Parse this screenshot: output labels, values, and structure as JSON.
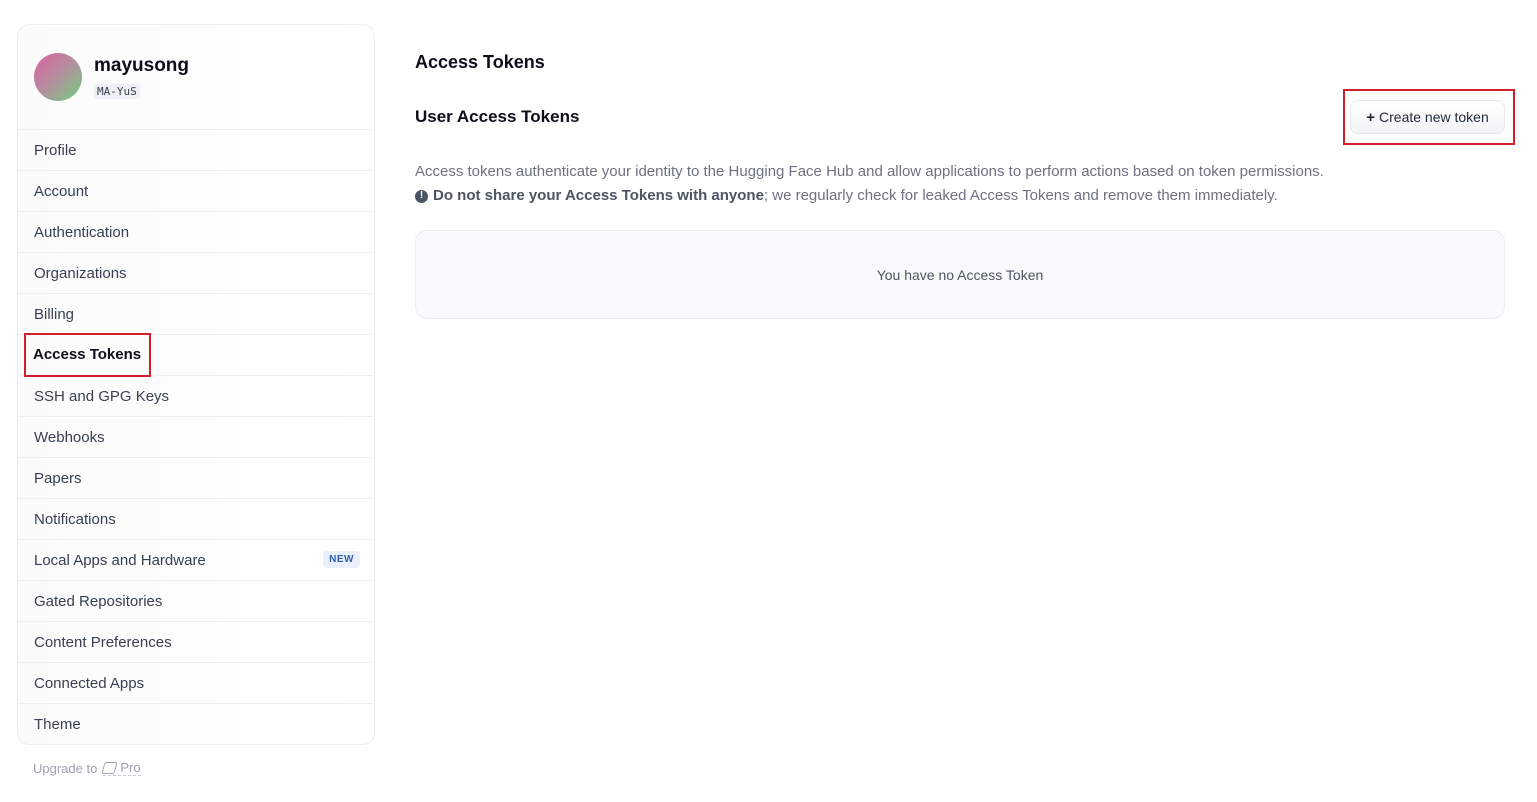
{
  "user": {
    "name": "mayusong",
    "handle": "MA-YuS"
  },
  "sidebar": {
    "items": [
      {
        "label": "Profile"
      },
      {
        "label": "Account"
      },
      {
        "label": "Authentication"
      },
      {
        "label": "Organizations"
      },
      {
        "label": "Billing"
      },
      {
        "label": "Access Tokens",
        "active": true
      },
      {
        "label": "SSH and GPG Keys"
      },
      {
        "label": "Webhooks"
      },
      {
        "label": "Papers"
      },
      {
        "label": "Notifications"
      },
      {
        "label": "Local Apps and Hardware",
        "badge": "NEW"
      },
      {
        "label": "Gated Repositories"
      },
      {
        "label": "Content Preferences"
      },
      {
        "label": "Connected Apps"
      },
      {
        "label": "Theme"
      }
    ],
    "upgrade_label": "Upgrade to",
    "pro_label": "Pro"
  },
  "main": {
    "title": "Access Tokens",
    "section_title": "User Access Tokens",
    "create_button": {
      "icon": "+",
      "label": "Create new token"
    },
    "description": "Access tokens authenticate your identity to the Hugging Face Hub and allow applications to perform actions based on token permissions.",
    "warning_bold": "Do not share your Access Tokens with anyone",
    "warning_rest": "; we regularly check for leaked Access Tokens and remove them immediately.",
    "empty_message": "You have no Access Token"
  },
  "colors": {
    "highlight_outline": "#d21f2a",
    "badge_text": "#2f5fb3",
    "badge_bg": "#eaf1fb"
  }
}
